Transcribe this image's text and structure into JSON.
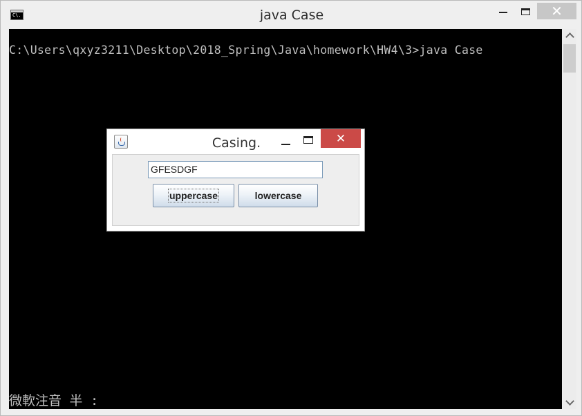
{
  "console_window": {
    "title": "java  Case",
    "icon_text": "C\\.",
    "close_label": "✕",
    "lines": [
      "C:\\Users\\qxyz3211\\Desktop\\2018_Spring\\Java\\homework\\HW4\\3>java Case"
    ],
    "ime_status": "微軟注音 半 :"
  },
  "dialog": {
    "title": "Casing.",
    "close_label": "✕",
    "text_field_value": "GFESDGF",
    "buttons": {
      "uppercase": "uppercase",
      "lowercase": "lowercase"
    }
  },
  "colors": {
    "console_background": "#000000",
    "console_text": "#c0c0c0",
    "dialog_close": "#cb4a47",
    "console_close": "#c7c7c7"
  }
}
